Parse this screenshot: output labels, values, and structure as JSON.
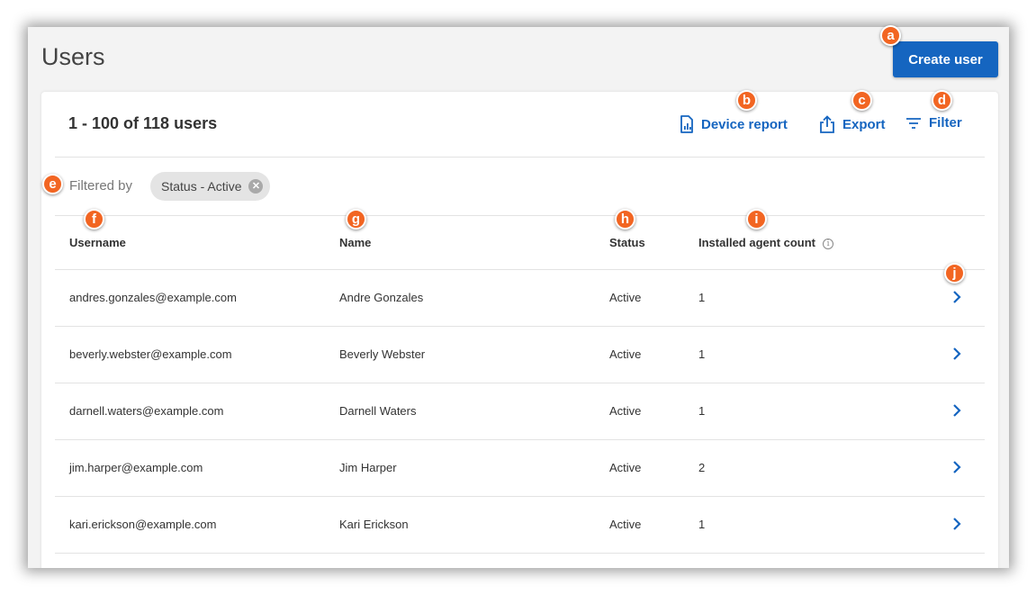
{
  "page": {
    "title": "Users",
    "create_button": "Create user"
  },
  "summary": {
    "count_text": "1 - 100 of 118 users"
  },
  "actions": {
    "device_report": "Device report",
    "export": "Export",
    "filter": "Filter"
  },
  "filters": {
    "label": "Filtered by",
    "chips": [
      {
        "label": "Status - Active"
      }
    ]
  },
  "table": {
    "columns": [
      "Username",
      "Name",
      "Status",
      "Installed agent count"
    ],
    "rows": [
      {
        "username": "andres.gonzales@example.com",
        "name": "Andre Gonzales",
        "status": "Active",
        "agents": "1"
      },
      {
        "username": "beverly.webster@example.com",
        "name": "Beverly Webster",
        "status": "Active",
        "agents": "1"
      },
      {
        "username": "darnell.waters@example.com",
        "name": "Darnell Waters",
        "status": "Active",
        "agents": "1"
      },
      {
        "username": "jim.harper@example.com",
        "name": "Jim Harper",
        "status": "Active",
        "agents": "2"
      },
      {
        "username": "kari.erickson@example.com",
        "name": "Kari Erickson",
        "status": "Active",
        "agents": "1"
      }
    ]
  },
  "callouts": [
    "a",
    "b",
    "c",
    "d",
    "e",
    "f",
    "g",
    "h",
    "i",
    "j"
  ],
  "colors": {
    "accent": "#1565c0",
    "callout": "#f26522"
  }
}
